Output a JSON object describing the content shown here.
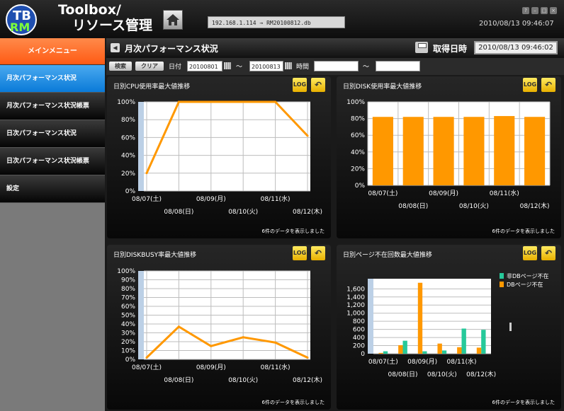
{
  "app": {
    "title_line1": "Toolbox/",
    "title_line2": "リソース管理",
    "connection": "192.168.1.114 → RM20100812.db",
    "clock": "2010/08/13 09:46:07",
    "logo_letters": "TBRM"
  },
  "sidebar": {
    "header": "メインメニュー",
    "items": [
      {
        "label": "月次パフォーマンス状況",
        "active": true
      },
      {
        "label": "月次パフォーマンス状況帳票",
        "active": false
      },
      {
        "label": "日次パフォーマンス状況",
        "active": false
      },
      {
        "label": "日次パフォーマンス状況帳票",
        "active": false
      },
      {
        "label": "設定",
        "active": false
      }
    ]
  },
  "topbar": {
    "title": "月次パフォーマンス状況",
    "fetch_label": "取得日時",
    "fetch_value": "2010/08/13 09:46:02"
  },
  "search": {
    "search_btn": "検索",
    "clear_btn": "クリア",
    "date_label": "日付",
    "date_from": "20100801",
    "tilde1": "～",
    "date_to": "20100813",
    "time_label": "時間",
    "time_from": "",
    "tilde2": "～",
    "time_to": ""
  },
  "panel_common": {
    "log_btn": "LOG",
    "footer": "6件のデータを表示しました"
  },
  "colors": {
    "orange": "#ff9800",
    "teal": "#26c99a",
    "plot_bg": "#ffffff",
    "grid": "#bdbdbd",
    "axis_bar": "#bcd0e6"
  },
  "chart_data": [
    {
      "id": "cpu",
      "type": "line",
      "title": "日別CPU使用率最大値推移",
      "categories": [
        "08/07(土)",
        "08/08(日)",
        "08/09(月)",
        "08/10(火)",
        "08/11(水)",
        "08/12(木)"
      ],
      "series": [
        {
          "values": [
            20,
            100,
            100,
            100,
            100,
            62
          ]
        }
      ],
      "ylim": [
        0,
        100
      ],
      "yticks": [
        "0%",
        "20%",
        "40%",
        "60%",
        "80%",
        "100%"
      ],
      "grid": true
    },
    {
      "id": "disk",
      "type": "bar",
      "title": "日別DISK使用率最大値推移",
      "categories": [
        "08/07(土)",
        "08/08(日)",
        "08/09(月)",
        "08/10(火)",
        "08/11(水)",
        "08/12(木)"
      ],
      "series": [
        {
          "values": [
            82,
            82,
            82,
            82,
            83,
            82
          ]
        }
      ],
      "ylim": [
        0,
        100
      ],
      "yticks": [
        "0%",
        "20%",
        "40%",
        "60%",
        "80%",
        "100%"
      ],
      "grid": true
    },
    {
      "id": "diskbusy",
      "type": "line",
      "title": "日別DISKBUSY率最大値推移",
      "categories": [
        "08/07(土)",
        "08/08(日)",
        "08/09(月)",
        "08/10(火)",
        "08/11(水)",
        "08/12(木)"
      ],
      "series": [
        {
          "values": [
            2,
            37,
            15,
            25,
            19,
            2
          ]
        }
      ],
      "ylim": [
        0,
        100
      ],
      "yticks": [
        "0%",
        "10%",
        "20%",
        "30%",
        "40%",
        "50%",
        "60%",
        "70%",
        "80%",
        "90%",
        "100%"
      ],
      "grid": true
    },
    {
      "id": "pagefault",
      "type": "bar",
      "title": "日別ページ不在回数最大値推移",
      "categories": [
        "08/07(土)",
        "08/08(日)",
        "08/09(月)",
        "08/10(火)",
        "08/11(水)",
        "08/12(木)"
      ],
      "series": [
        {
          "name": "非DBページ不在",
          "values": [
            60,
            320,
            60,
            80,
            620,
            590
          ]
        },
        {
          "name": "DBページ不在",
          "values": [
            20,
            210,
            1750,
            250,
            160,
            150
          ]
        }
      ],
      "ylim": [
        0,
        1850
      ],
      "yticks": [
        "0",
        "200",
        "400",
        "600",
        "800",
        "1,000",
        "1,200",
        "1,400",
        "1,600"
      ],
      "ytick_values": [
        0,
        200,
        400,
        600,
        800,
        1000,
        1200,
        1400,
        1600
      ],
      "grid": true,
      "legend": "top-right"
    }
  ]
}
